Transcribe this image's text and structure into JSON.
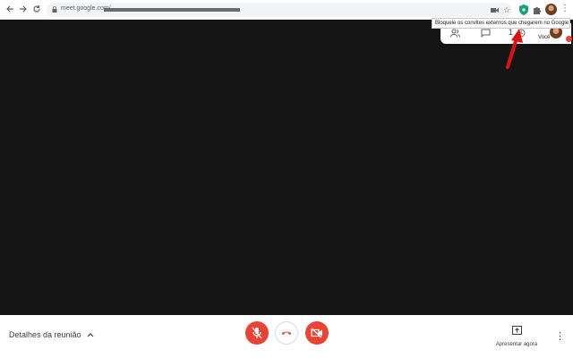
{
  "browser": {
    "url": "meet.google.com/",
    "nav": {
      "back_icon": "arrow-left-icon",
      "forward_icon": "arrow-right-icon",
      "reload_icon": "reload-icon"
    },
    "extensions": [
      "camera-icon",
      "star-icon",
      "shield-extension-icon",
      "puzzle-icon"
    ]
  },
  "tooltip": {
    "text": "Bloqueie os convites externos que chegarem no Google Meet"
  },
  "meet_panel": {
    "participant_count": "1",
    "self_label": "Você",
    "icons": [
      "people-icon",
      "chat-icon",
      "clock-icon"
    ]
  },
  "bottom_bar": {
    "details_label": "Detalhes da reunião",
    "present_label": "Apresentar agora"
  },
  "colors": {
    "video_bg": "#151515",
    "accent_red": "#ea4335",
    "arrow_red": "#e01010"
  }
}
